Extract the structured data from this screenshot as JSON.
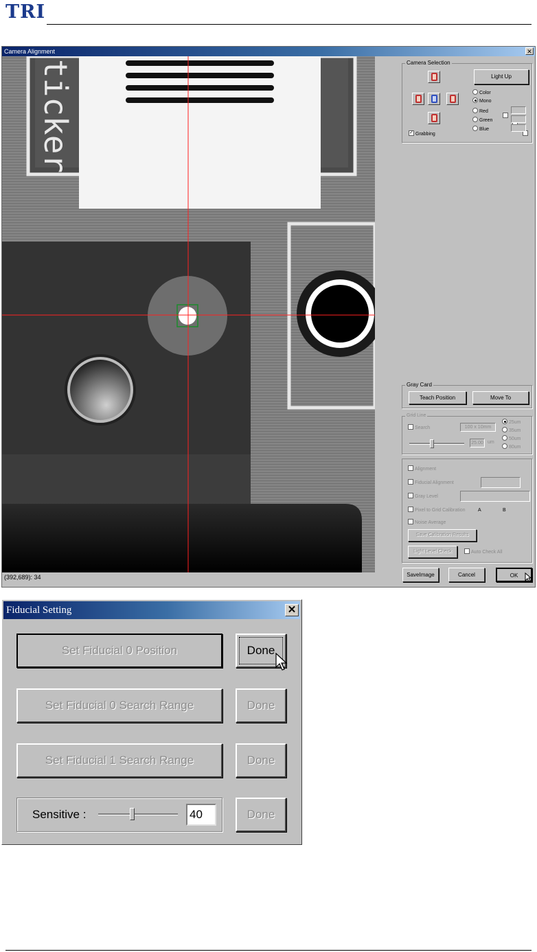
{
  "header": {
    "logo_text": "TRI"
  },
  "camera_window": {
    "title": "Camera Alignment",
    "close_glyph": "✕",
    "view_text": "ticker",
    "status_text": "(392,689): 34",
    "camera_selection": {
      "label": "Camera Selection",
      "light_up": "Light Up",
      "color_options": [
        {
          "label": "Color",
          "selected": false
        },
        {
          "label": "Mono",
          "selected": true
        }
      ],
      "channels": [
        {
          "label": "Red"
        },
        {
          "label": "Green"
        },
        {
          "label": "Blue"
        }
      ],
      "grabbing_label": "Grabbing",
      "grabbing_checked": true
    },
    "gray_card": {
      "label": "Gray Card",
      "teach_position": "Teach Position",
      "move_to": "Move To"
    },
    "dimmed_group": {
      "label": "Grid Line",
      "search_label": "Search",
      "range_value": "100 x 10mm",
      "slider_value": "25.00",
      "slider_unit": "um",
      "radio_options": [
        "25um",
        "35um",
        "50um",
        "80um"
      ]
    },
    "options_group": {
      "items": [
        "Alignment",
        "Fiducial Alignment",
        "Gray Level",
        "Pixel to Grid Calibration",
        "Noise Average"
      ],
      "col_a": "A",
      "col_b": "B",
      "save_calibration": "Save Calibration Results",
      "light_level_check": "Light Level Check",
      "auto_check_label": "Auto Check All"
    },
    "bottom_buttons": {
      "save_image": "SaveImage",
      "cancel": "Cancel",
      "ok": "OK"
    }
  },
  "fiducial_dialog": {
    "title": "Fiducial Setting",
    "close_glyph": "✕",
    "rows": [
      {
        "action": "Set Fiducial 0 Position",
        "done": "Done",
        "enabled": true
      },
      {
        "action": "Set Fiducial 0 Search Range",
        "done": "Done",
        "enabled": false
      },
      {
        "action": "Set Fiducial 1 Search Range",
        "done": "Done",
        "enabled": false
      }
    ],
    "sensitive": {
      "label": "Sensitive :",
      "value": "40",
      "done": "Done",
      "slider_fraction": 0.42
    }
  },
  "colors": {
    "title_bar": "#0a246a",
    "crosshair": "#ff2020",
    "fiducial_box": "#1c8c2c",
    "logo": "#1b3a8c"
  }
}
